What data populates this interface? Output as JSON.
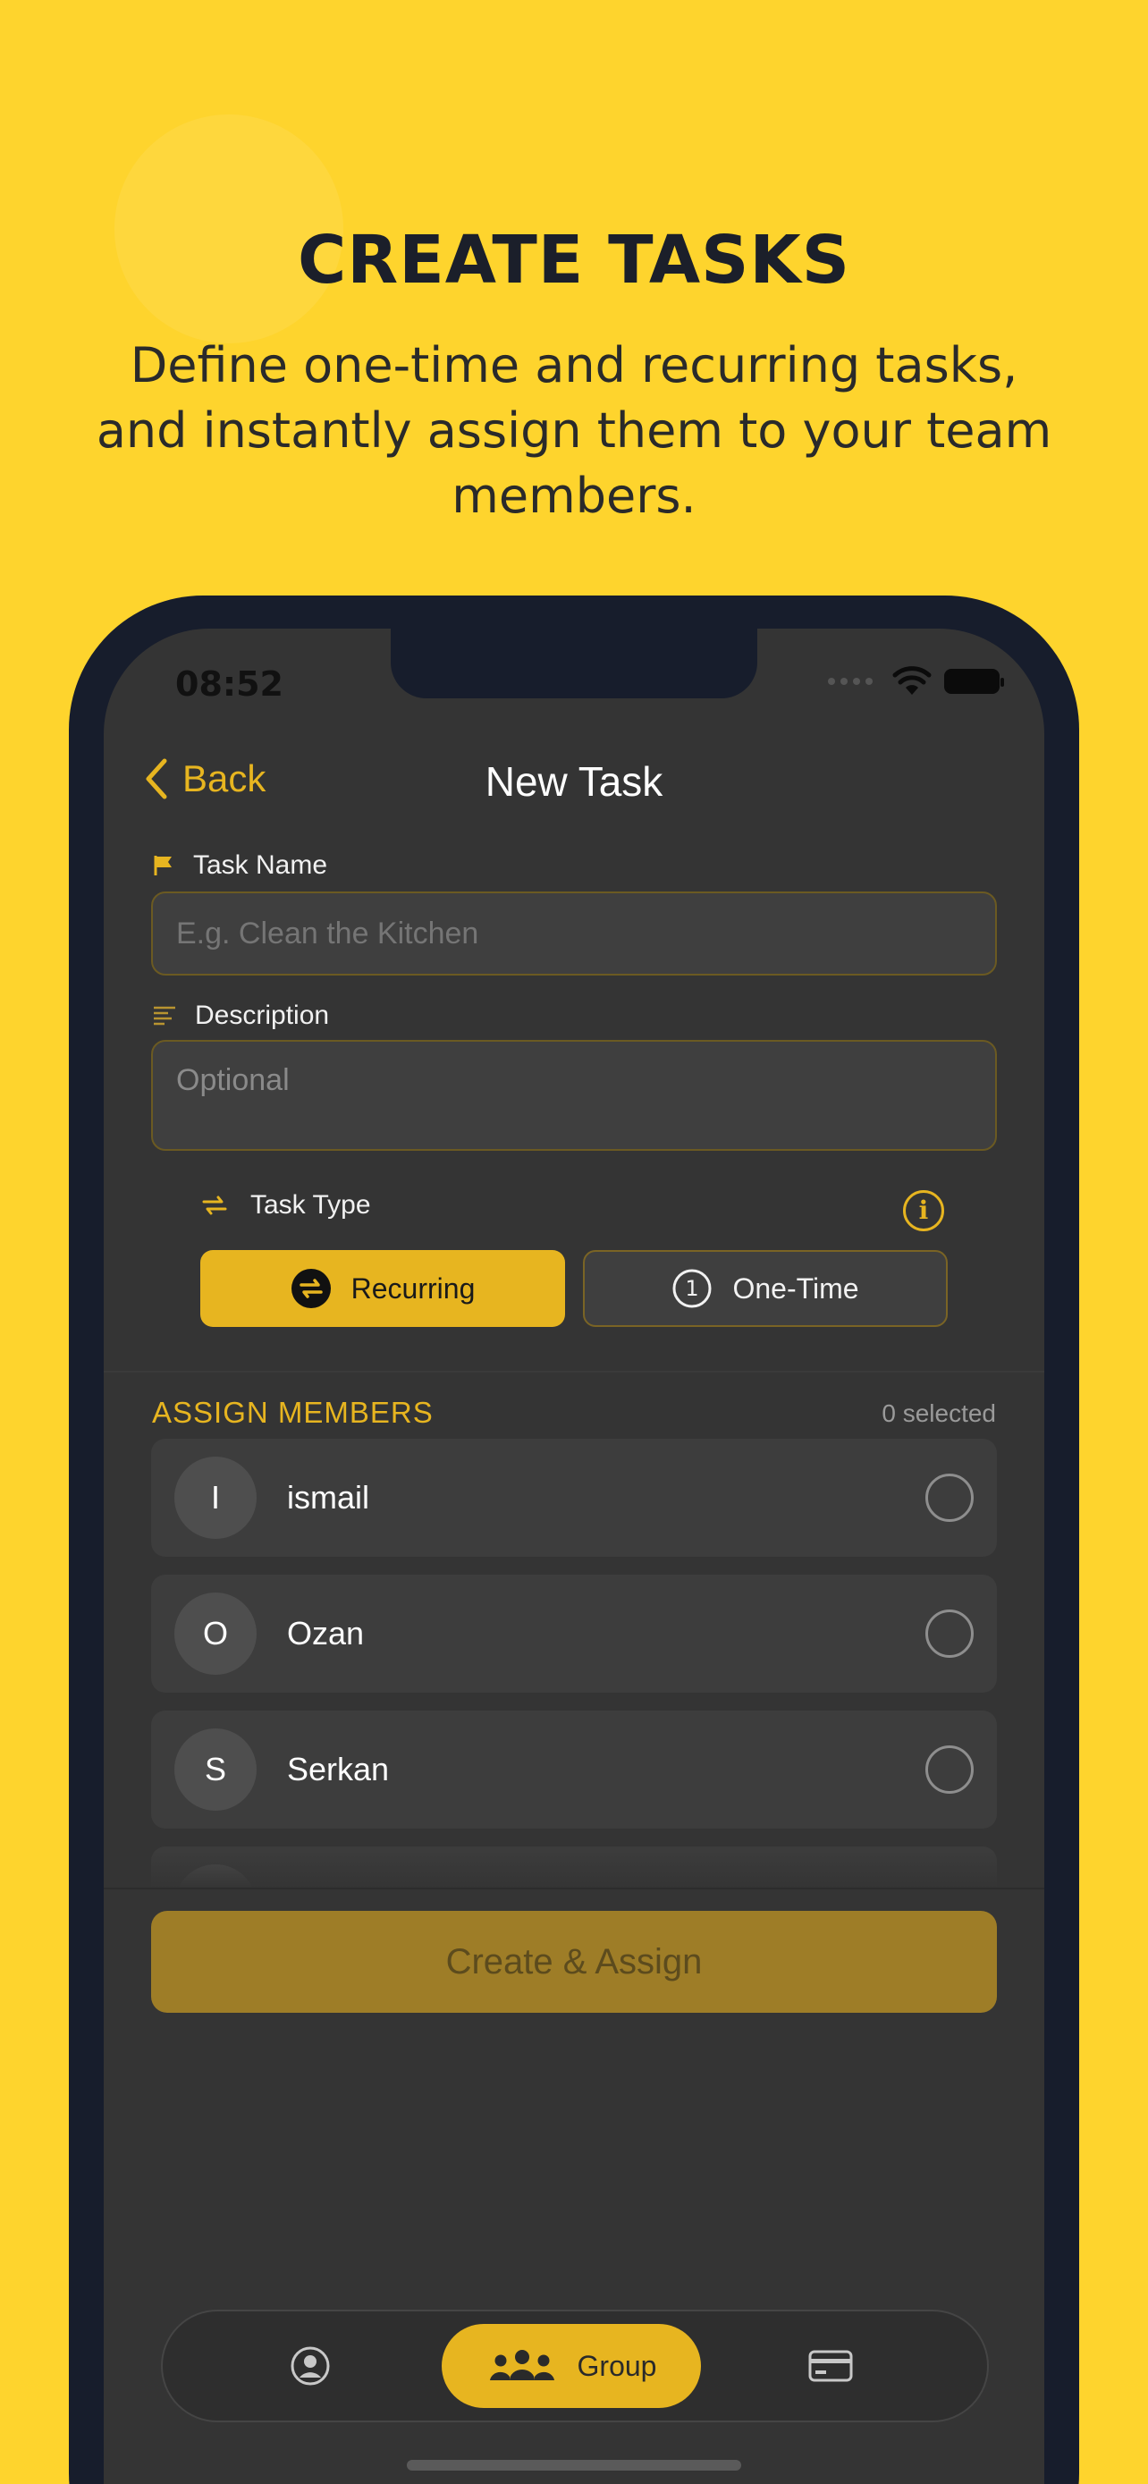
{
  "promo": {
    "headline": "CREATE TASKS",
    "subline": "Define one-time and recurring tasks, and instantly assign them to your team members."
  },
  "status_bar": {
    "time": "08:52",
    "icons": [
      "signal-icon",
      "wifi-icon",
      "battery-icon"
    ]
  },
  "nav": {
    "back_label": "Back",
    "title": "New Task"
  },
  "form": {
    "task_name": {
      "label": "Task Name",
      "placeholder": "E.g. Clean the Kitchen",
      "value": ""
    },
    "description": {
      "label": "Description",
      "placeholder": "Optional",
      "value": ""
    },
    "task_type": {
      "label": "Task Type",
      "options": [
        {
          "label": "Recurring",
          "selected": true
        },
        {
          "label": "One-Time",
          "selected": false
        }
      ]
    }
  },
  "assign": {
    "title": "ASSIGN MEMBERS",
    "count_label": "0 selected",
    "members": [
      {
        "initial": "I",
        "name": "ismail",
        "selected": false
      },
      {
        "initial": "O",
        "name": "Ozan",
        "selected": false
      },
      {
        "initial": "S",
        "name": "Serkan",
        "selected": false
      }
    ]
  },
  "primary_action": {
    "label": "Create & Assign",
    "enabled": false
  },
  "tabbar": {
    "items": [
      {
        "name": "profile",
        "label": "",
        "active": false
      },
      {
        "name": "group",
        "label": "Group",
        "active": true
      },
      {
        "name": "billing",
        "label": "",
        "active": false
      }
    ]
  },
  "colors": {
    "background": "#FED42D",
    "accent": "#E7B520",
    "screen": "#343434",
    "frame": "#171D2C"
  }
}
